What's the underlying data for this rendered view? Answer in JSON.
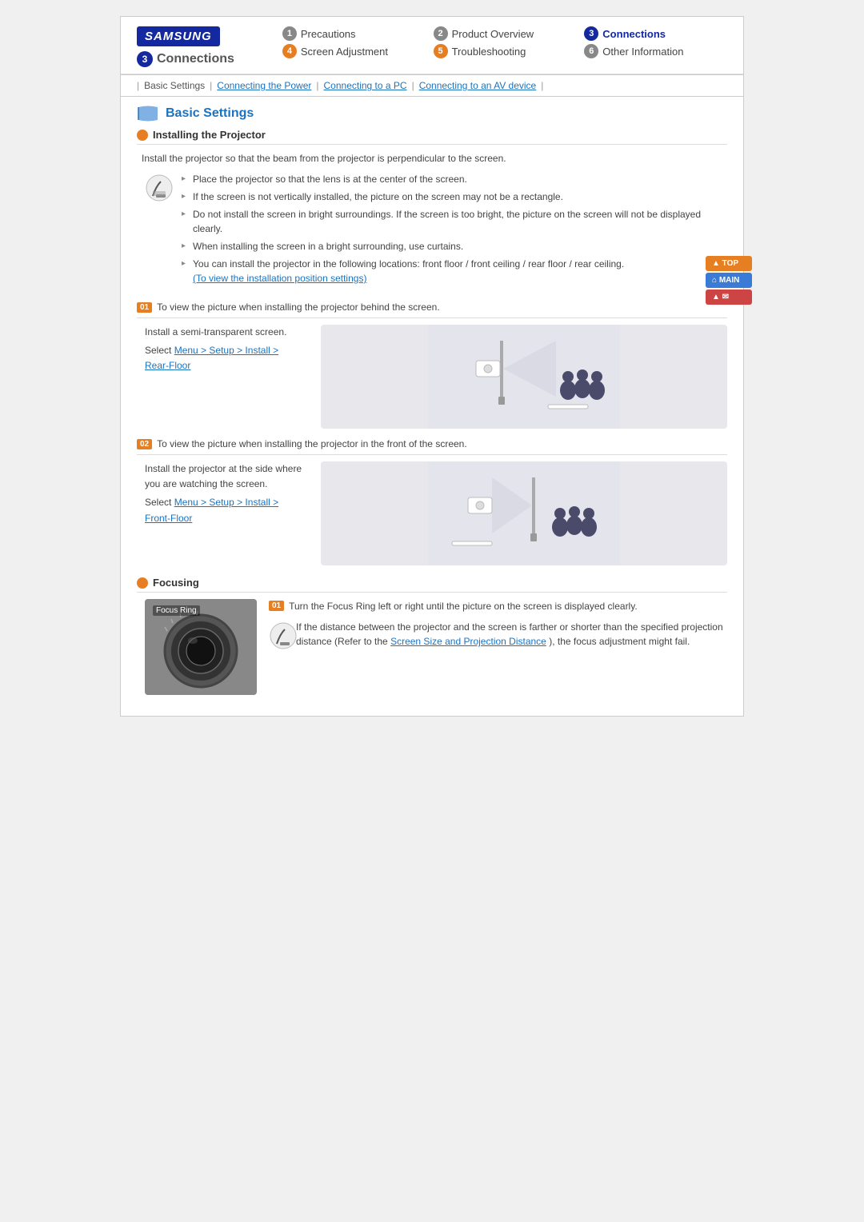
{
  "header": {
    "logo": "SAMSUNG",
    "current_section": "Connections",
    "current_num": "3",
    "nav_items": [
      {
        "num": "1",
        "label": "Precautions",
        "active": false
      },
      {
        "num": "2",
        "label": "Product Overview",
        "active": false
      },
      {
        "num": "3",
        "label": "Connections",
        "active": true
      },
      {
        "num": "4",
        "label": "Screen Adjustment",
        "active": false
      },
      {
        "num": "5",
        "label": "Troubleshooting",
        "active": false
      },
      {
        "num": "6",
        "label": "Other Information",
        "active": false
      }
    ]
  },
  "breadcrumb": {
    "separator": "|",
    "items": [
      {
        "label": "Basic Settings",
        "active": false
      },
      {
        "label": "Connecting the Power",
        "active": true
      },
      {
        "label": "Connecting to a PC",
        "active": false
      },
      {
        "label": "Connecting to an AV device",
        "active": false
      }
    ]
  },
  "page_title": "Basic Settings",
  "sections": [
    {
      "id": "installing-projector",
      "title": "Installing the Projector",
      "intro": "Install the projector so that the beam from the projector is perpendicular to the screen.",
      "instructions": [
        "Place the projector so that the lens is at the center of the screen.",
        "If the screen is not vertically installed, the picture on the screen may not be a rectangle.",
        "Do not install the screen in bright surroundings. If the screen is too bright, the picture on the screen will not be displayed clearly.",
        "When installing the screen in a bright surrounding, use curtains.",
        "You can install the projector in the following locations: front floor / front ceiling / rear floor / rear ceiling."
      ],
      "link_text": "(To view the installation position settings)",
      "tip1": {
        "badge": "01",
        "header_text": "To view the picture when installing the projector behind the screen.",
        "description_line1": "Install a semi-transparent screen.",
        "description_line2": "Select",
        "menu_path": "Menu > Setup > Install > Rear-Floor"
      },
      "tip2": {
        "badge": "02",
        "header_text": "To view the picture when installing the projector in the front of the screen.",
        "description_line1": "Install the projector at the side where you are watching the screen.",
        "description_line2": "Select",
        "menu_path": "Menu > Setup > Install > Front-Floor"
      }
    },
    {
      "id": "focusing",
      "title": "Focusing",
      "tip_badge": "01",
      "focus_main": "Turn the Focus Ring left or right until the picture on the screen is displayed clearly.",
      "focus_note": "If the distance between the projector and the screen is farther or shorter than the specified projection distance (Refer to the",
      "focus_link": "Screen Size and Projection Distance",
      "focus_note_end": "), the focus adjustment might fail.",
      "focus_label": "Focus Ring"
    }
  ],
  "floating_buttons": [
    {
      "label": "▲ TOP",
      "type": "orange"
    },
    {
      "label": "⌂ MAIN",
      "type": "blue"
    },
    {
      "label": "▲ ✉",
      "type": "red"
    }
  ]
}
